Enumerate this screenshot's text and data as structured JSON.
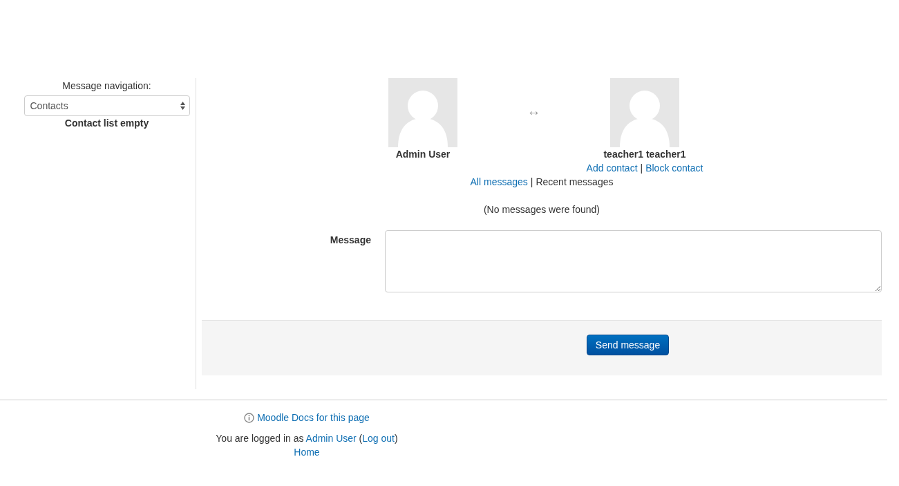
{
  "sidebar": {
    "label": "Message navigation:",
    "select": {
      "value": "Contacts"
    },
    "empty_note": "Contact list empty"
  },
  "conversation": {
    "user": {
      "name": "Admin User"
    },
    "arrow": "↔",
    "other": {
      "name": "teacher1 teacher1",
      "actions": [
        "Add contact",
        "Block contact"
      ],
      "separator": "|"
    }
  },
  "history_links": [
    {
      "label": "All messages",
      "kind": "link"
    },
    {
      "label": "Recent messages",
      "kind": "text"
    }
  ],
  "history_separator": "|",
  "no_messages": "(No messages were found)",
  "form": {
    "label": "Message",
    "button": "Send message"
  },
  "footer": {
    "docs_link": "Moodle Docs for this page",
    "login": {
      "prefix": "You are logged in as ",
      "user": "Admin User",
      "open": " (",
      "logout": "Log out",
      "close": ")"
    },
    "home": "Home"
  }
}
